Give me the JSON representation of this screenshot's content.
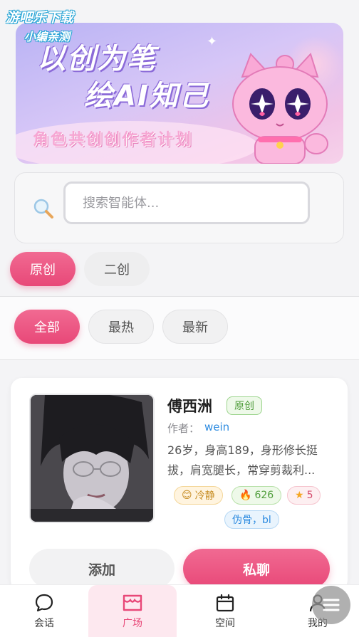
{
  "watermark": {
    "line1": "游吧乐下载",
    "line2": "小编亲测"
  },
  "banner": {
    "line1": "以创为笔",
    "line2": "绘AI知己",
    "line3": "角色共创创作者计划"
  },
  "search": {
    "placeholder": "搜索智能体..."
  },
  "type_tabs": [
    {
      "label": "原创",
      "active": true
    },
    {
      "label": "二创",
      "active": false
    }
  ],
  "filter_tabs": [
    {
      "label": "全部",
      "active": true
    },
    {
      "label": "最热",
      "active": false
    },
    {
      "label": "最新",
      "active": false
    }
  ],
  "agent_card": {
    "name": "傅西洲",
    "badge": "原创",
    "author_label": "作者：",
    "author_name": "wein",
    "description": "26岁，身高189，身形修长挺拔，肩宽腿长，常穿剪裁利...",
    "tags": {
      "mood": "冷静",
      "heat": "626",
      "stars": "5",
      "genre": "伪骨，bl"
    },
    "add_label": "添加",
    "chat_label": "私聊"
  },
  "bottom_nav": [
    {
      "label": "会话",
      "icon": "chat-bubble-icon",
      "active": false
    },
    {
      "label": "广场",
      "icon": "storefront-icon",
      "active": true
    },
    {
      "label": "空间",
      "icon": "calendar-icon",
      "active": false
    },
    {
      "label": "我的",
      "icon": "person-icon",
      "active": false
    }
  ],
  "colors": {
    "accent": "#e84878",
    "link": "#2d8be0",
    "original_badge": "#4f9d3a"
  }
}
